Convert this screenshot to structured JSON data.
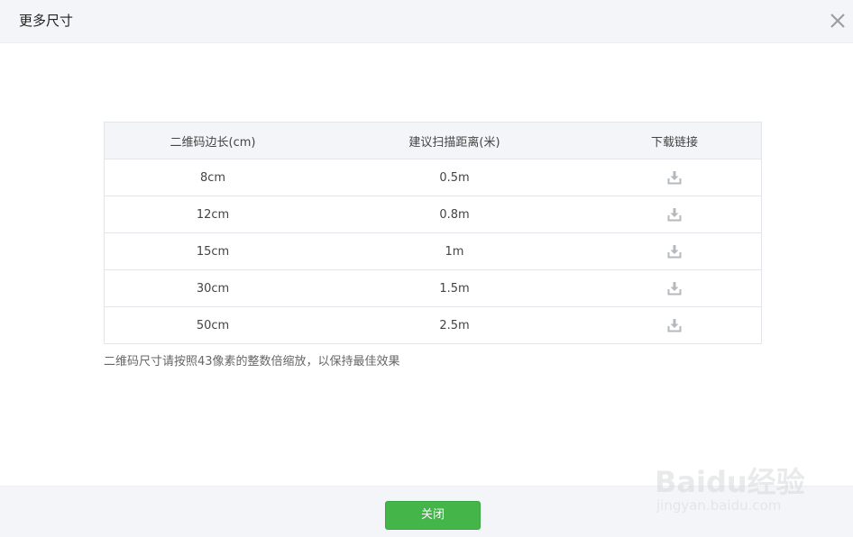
{
  "dialog": {
    "title": "更多尺寸",
    "close_icon": "close-icon"
  },
  "table": {
    "headers": [
      "二维码边长(cm)",
      "建议扫描距离(米)",
      "下载链接"
    ],
    "rows": [
      {
        "side": "8cm",
        "distance": "0.5m",
        "download_icon": "download-icon"
      },
      {
        "side": "12cm",
        "distance": "0.8m",
        "download_icon": "download-icon"
      },
      {
        "side": "15cm",
        "distance": "1m",
        "download_icon": "download-icon"
      },
      {
        "side": "30cm",
        "distance": "1.5m",
        "download_icon": "download-icon"
      },
      {
        "side": "50cm",
        "distance": "2.5m",
        "download_icon": "download-icon"
      }
    ]
  },
  "note": "二维码尺寸请按照43像素的整数倍缩放，以保持最佳效果",
  "footer": {
    "close_label": "关闭"
  },
  "watermark": {
    "brand": "Baidu经验",
    "url": "jingyan.baidu.com"
  },
  "colors": {
    "primary_button": "#44b549",
    "header_bg": "#f4f5f9",
    "border": "#e3e5ea"
  }
}
